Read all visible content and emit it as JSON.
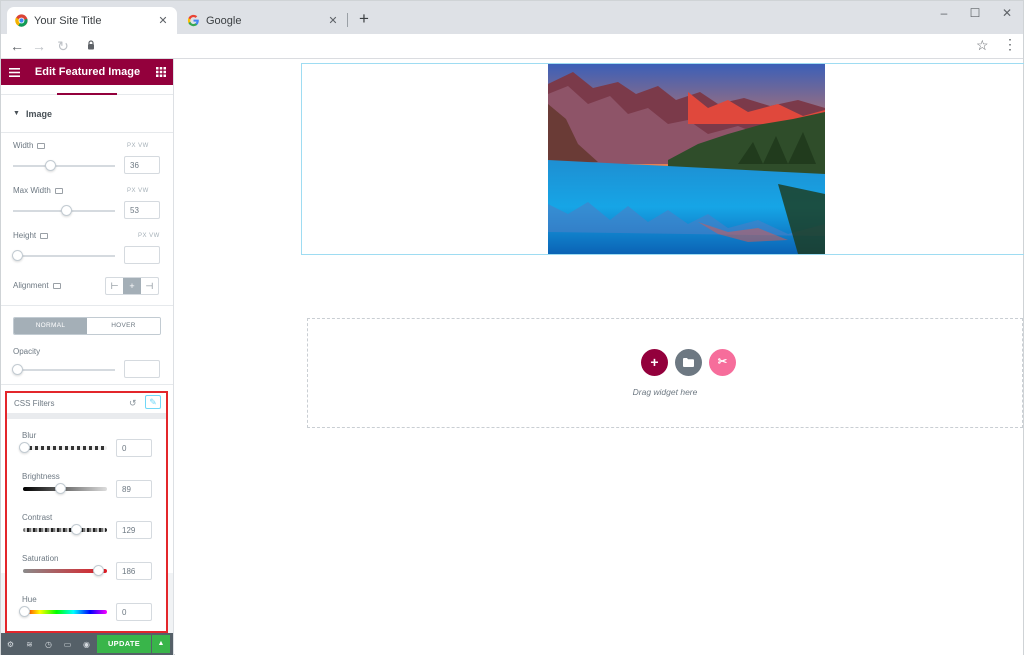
{
  "browser": {
    "tabs": [
      {
        "title": "Your Site Title",
        "favicon": "chrome-icon"
      },
      {
        "title": "Google",
        "favicon": "google-g-icon"
      }
    ],
    "close_glyph": "✕",
    "new_tab_glyph": "+",
    "window_controls": {
      "minimize": "–",
      "maximize": "☐",
      "close": "✕"
    }
  },
  "panel": {
    "header_title": "Edit Featured Image",
    "section_title": "Image",
    "width": {
      "label": "Width",
      "units": "PX  VW",
      "value": "36",
      "percent": 36
    },
    "max_width": {
      "label": "Max Width",
      "units": "PX  VW",
      "value": "53",
      "percent": 53
    },
    "height": {
      "label": "Height",
      "units": "PX  VW",
      "value": "",
      "percent": 0
    },
    "alignment": {
      "label": "Alignment",
      "options": [
        "⊢",
        "+",
        "⊣"
      ],
      "selected": 1
    },
    "state_tabs": [
      "NORMAL",
      "HOVER"
    ],
    "opacity": {
      "label": "Opacity",
      "value": "",
      "percent": 0
    },
    "css_filters": {
      "title": "CSS Filters",
      "blur": {
        "label": "Blur",
        "value": "0",
        "position": 0.0
      },
      "brightness": {
        "label": "Brightness",
        "value": "89",
        "position": 0.445
      },
      "contrast": {
        "label": "Contrast",
        "value": "129",
        "position": 0.645
      },
      "saturation": {
        "label": "Saturation",
        "value": "186",
        "position": 0.93
      },
      "hue": {
        "label": "Hue",
        "value": "0",
        "position": 0.0
      }
    },
    "footer": {
      "update_label": "UPDATE",
      "update_arrow": "▲"
    }
  },
  "preview": {
    "drop_text": "Drag widget here"
  },
  "colors": {
    "brand": "#93003c",
    "update_green": "#39b54a",
    "highlight_red": "#e3262b",
    "add_button": "#93003c",
    "template_button": "#6d7882",
    "kit_button": "#f66d9b"
  }
}
